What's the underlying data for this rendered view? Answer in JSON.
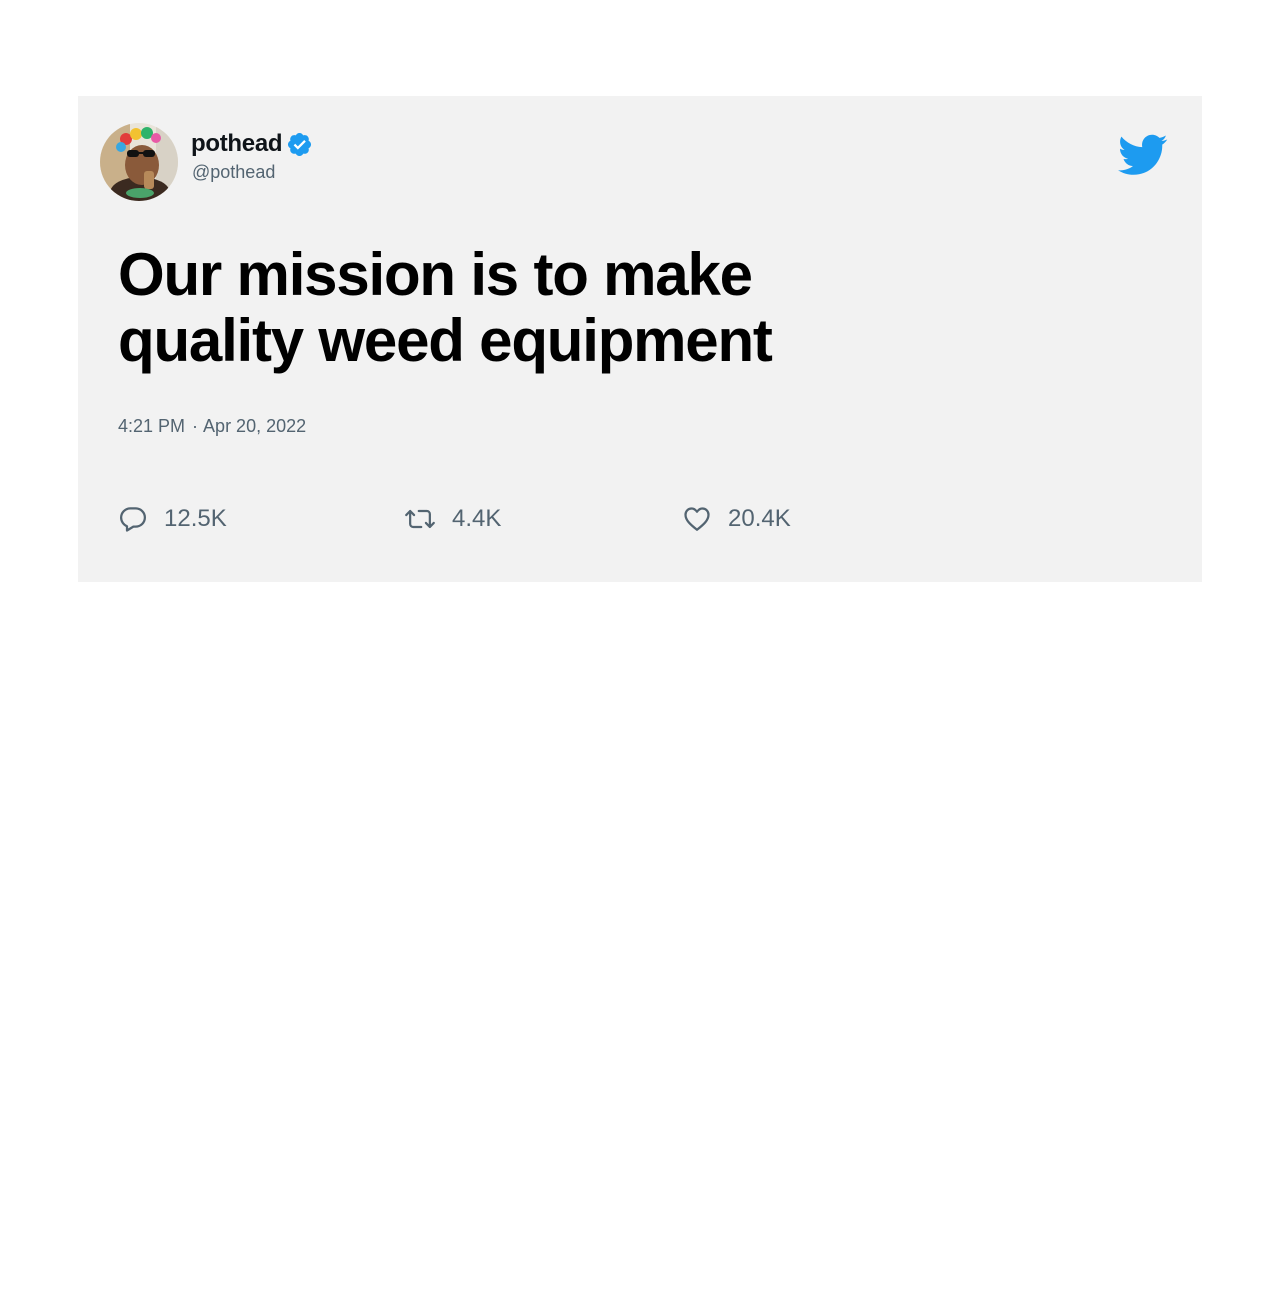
{
  "tweet": {
    "author": {
      "display_name": "pothead",
      "handle": "@pothead",
      "verified": true,
      "avatar": "avatar-photo"
    },
    "text": "Our mission is to make quality weed equipment",
    "time": "4:21 PM",
    "separator": "·",
    "date": "Apr 20, 2022",
    "stats": {
      "replies": "12.5K",
      "retweets": "4.4K",
      "likes": "20.4K"
    }
  },
  "icons": {
    "brand": "twitter-bird-icon",
    "verified": "verified-badge-icon",
    "reply": "reply-icon",
    "retweet": "retweet-icon",
    "like": "heart-icon"
  },
  "colors": {
    "card_background": "#f2f2f2",
    "brand_blue": "#1d9bf0",
    "text_primary": "#0f1419",
    "text_secondary": "#536471"
  }
}
